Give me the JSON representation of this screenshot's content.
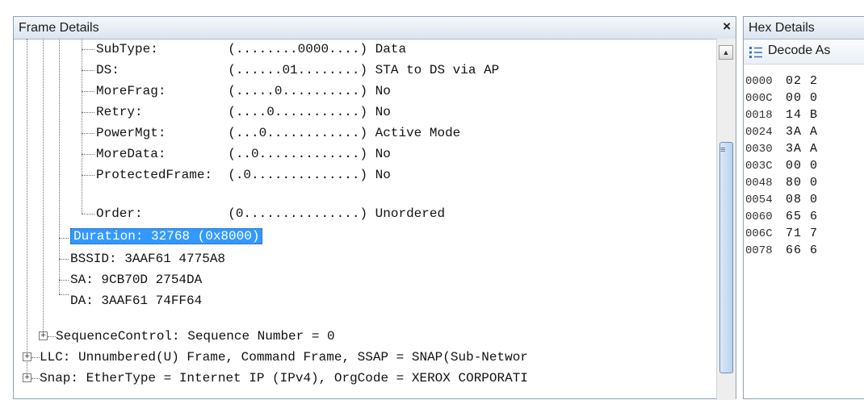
{
  "frame_details": {
    "title": "Frame Details",
    "close_symbol": "×",
    "rows": [
      {
        "text": "SubType:         (........0000....) Data"
      },
      {
        "text": "DS:              (......01........) STA to DS via AP"
      },
      {
        "text": "MoreFrag:        (.....0..........) No"
      },
      {
        "text": "Retry:           (....0...........) No"
      },
      {
        "text": "PowerMgt:        (...0............) Active Mode"
      },
      {
        "text": "MoreData:        (..0.............) No"
      },
      {
        "text": "ProtectedFrame:  (.0..............) No"
      },
      {
        "text": "Order:           (0...............) Unordered"
      },
      {
        "text": "Duration: 32768 (0x8000)",
        "selected": true
      },
      {
        "text": "BSSID: 3AAF61 4775A8"
      },
      {
        "text": "SA: 9CB70D 2754DA"
      },
      {
        "text": "DA: 3AAF61 74FF64"
      },
      {
        "text": "SequenceControl: Sequence Number = 0",
        "expander": "+"
      },
      {
        "text": "LLC: Unnumbered(U) Frame, Command Frame, SSAP = SNAP(Sub-Networ",
        "expander": "+"
      },
      {
        "text": "Snap: EtherType = Internet IP (IPv4), OrgCode = XEROX CORPORATI",
        "expander": "+"
      }
    ]
  },
  "hex_details": {
    "title": "Hex Details",
    "decode_as_label": "Decode As",
    "decode_icon": "decode-as-icon",
    "rows": [
      {
        "offset": "0000",
        "bytes": "02 2"
      },
      {
        "offset": "000C",
        "bytes": "00 0"
      },
      {
        "offset": "0018",
        "bytes": "14 B"
      },
      {
        "offset": "0024",
        "bytes": "3A A"
      },
      {
        "offset": "0030",
        "bytes": "3A A"
      },
      {
        "offset": "003C",
        "bytes": "00 0"
      },
      {
        "offset": "0048",
        "bytes": "80 0"
      },
      {
        "offset": "0054",
        "bytes": "08 0"
      },
      {
        "offset": "0060",
        "bytes": "65 6"
      },
      {
        "offset": "006C",
        "bytes": "71 7"
      },
      {
        "offset": "0078",
        "bytes": "66 6"
      }
    ]
  },
  "colors": {
    "selection": "#3399ff",
    "titlebar": "#dce5f0",
    "scroll_thumb": "#b9d2ee"
  }
}
